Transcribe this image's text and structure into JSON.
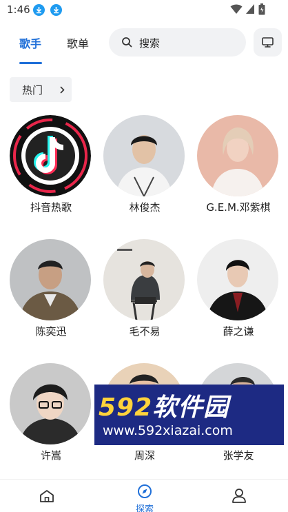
{
  "status_bar": {
    "time": "1:46"
  },
  "header": {
    "tabs": [
      {
        "label": "歌手",
        "active": true
      },
      {
        "label": "歌单",
        "active": false
      }
    ],
    "search": {
      "placeholder": "搜索"
    }
  },
  "filter_chip": {
    "label": "热门"
  },
  "artists": [
    {
      "name": "抖音热歌"
    },
    {
      "name": "林俊杰"
    },
    {
      "name": "G.E.M.邓紫棋"
    },
    {
      "name": "陈奕迅"
    },
    {
      "name": "毛不易"
    },
    {
      "name": "薛之谦"
    },
    {
      "name": "许嵩"
    },
    {
      "name": "周深"
    },
    {
      "name": "张学友"
    }
  ],
  "watermark": {
    "brand_number": "592",
    "brand_cn": "软件园",
    "url": "www.592xiazai.com"
  },
  "bottom_nav": {
    "items": [
      {
        "icon": "home-icon",
        "label": ""
      },
      {
        "icon": "compass-icon",
        "label": "探索",
        "active": true
      },
      {
        "icon": "person-icon",
        "label": ""
      }
    ]
  },
  "colors": {
    "accent": "#1f6fd8",
    "download_badge": "#1f9bf0",
    "chip_bg": "#f1f2f4"
  }
}
